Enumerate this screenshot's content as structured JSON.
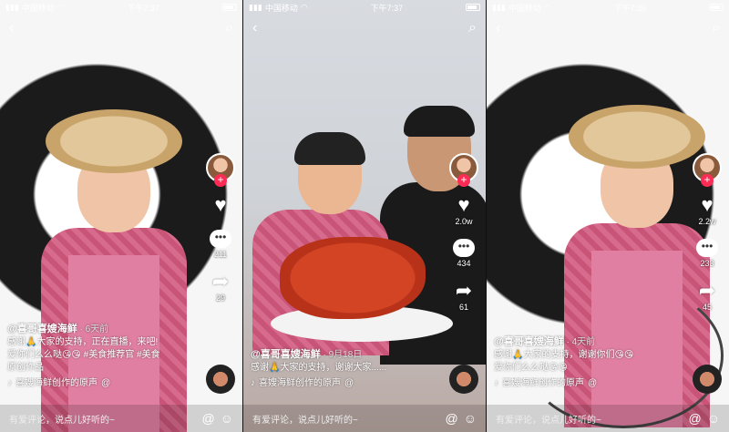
{
  "screens": [
    {
      "status": {
        "carrier": "中国移动",
        "time": "下午7:37"
      },
      "like_count": "",
      "comment_count": "211",
      "share_count": "29",
      "author": "@喜哥喜嫂海鲜",
      "time_ago": "· 6天前",
      "caption_line1": "感谢🙏大家的支持，正在直播，来吧!",
      "caption_line2": "爱你们么么哒😘😘 #美食推荐官 #美食",
      "caption_line3": "原创作品",
      "music": "喜嫂海鲜创作的原声",
      "music_tag": "@",
      "comment_placeholder": "有爱评论，说点儿好听的~"
    },
    {
      "status": {
        "carrier": "中国移动",
        "time": "下午7:37"
      },
      "like_count": "2.0w",
      "comment_count": "434",
      "share_count": "61",
      "author": "@喜哥喜嫂海鲜",
      "time_ago": "· 9月18日",
      "caption_line1": "感谢🙏大家的支持，谢谢大家......",
      "caption_line2": "",
      "caption_line3": "",
      "music": "喜嫂海鲜创作的原声",
      "music_tag": "@",
      "comment_placeholder": "有爱评论，说点儿好听的~"
    },
    {
      "status": {
        "carrier": "中国移动",
        "time": "下午7:36"
      },
      "like_count": "2.2w",
      "comment_count": "233",
      "share_count": "45",
      "author": "@喜哥喜嫂海鲜",
      "time_ago": "· 4天前",
      "caption_line1": "感谢🙏大家的支持，谢谢你们😘😘",
      "caption_line2": "爱你们么么哒😘😘",
      "caption_line3": "",
      "music": "喜嫂海鲜创作的原声",
      "music_tag": "@",
      "comment_placeholder": "有爱评论，说点儿好听的~"
    }
  ],
  "icons": {
    "back": "‹",
    "search": "⌕",
    "like": "♥",
    "comment": "•••",
    "share": "➦",
    "music": "♪",
    "at": "@",
    "emoji": "☺"
  }
}
